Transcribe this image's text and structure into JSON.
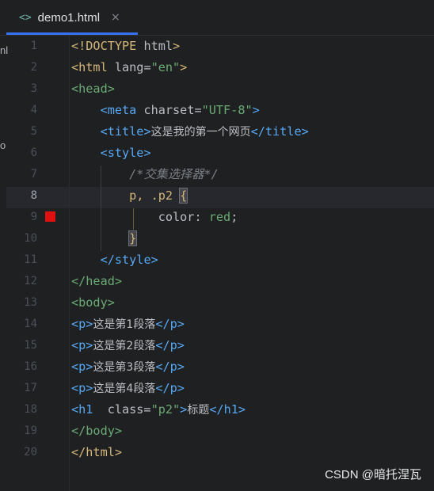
{
  "tab": {
    "icon": "<>",
    "filename": "demo1.html",
    "close": "×"
  },
  "edge_fragments": [
    "nl",
    "o"
  ],
  "gutter": {
    "breakpoint_line": 9,
    "current_line": 8
  },
  "lines": [
    {
      "n": "1",
      "segs": [
        {
          "t": "<!DOCTYPE ",
          "c": "tag"
        },
        {
          "t": "html",
          "c": "att"
        },
        {
          "t": ">",
          "c": "tag"
        }
      ]
    },
    {
      "n": "2",
      "segs": [
        {
          "t": "<html ",
          "c": "tag"
        },
        {
          "t": "lang=",
          "c": "att"
        },
        {
          "t": "\"en\"",
          "c": "str"
        },
        {
          "t": ">",
          "c": "tag"
        }
      ]
    },
    {
      "n": "3",
      "segs": [
        {
          "t": "<head>",
          "c": "str"
        }
      ]
    },
    {
      "n": "4",
      "segs": [
        {
          "t": "    ",
          "c": "att"
        },
        {
          "t": "<meta ",
          "c": "sty"
        },
        {
          "t": "charset=",
          "c": "att"
        },
        {
          "t": "\"UTF-8\"",
          "c": "str"
        },
        {
          "t": ">",
          "c": "sty"
        }
      ]
    },
    {
      "n": "5",
      "segs": [
        {
          "t": "    ",
          "c": "att"
        },
        {
          "t": "<title>",
          "c": "sty"
        },
        {
          "t": "这是我的第一个网页",
          "c": "cn"
        },
        {
          "t": "</title>",
          "c": "sty"
        }
      ]
    },
    {
      "n": "6",
      "segs": [
        {
          "t": "    ",
          "c": "att"
        },
        {
          "t": "<style>",
          "c": "sty"
        }
      ]
    },
    {
      "n": "7",
      "segs": [
        {
          "t": "        ",
          "c": "att"
        },
        {
          "t": "/*交集选择器*/",
          "c": "cmt"
        }
      ]
    },
    {
      "n": "8",
      "segs": [
        {
          "t": "        ",
          "c": "att"
        },
        {
          "t": "p, .p2 ",
          "c": "tag"
        },
        {
          "t": "{",
          "c": "tag brace-hl"
        }
      ]
    },
    {
      "n": "9",
      "segs": [
        {
          "t": "            ",
          "c": "att"
        },
        {
          "t": "color",
          "c": "att"
        },
        {
          "t": ": ",
          "c": "att"
        },
        {
          "t": "red",
          "c": "str"
        },
        {
          "t": ";",
          "c": "att"
        }
      ]
    },
    {
      "n": "10",
      "segs": [
        {
          "t": "        ",
          "c": "att"
        },
        {
          "t": "}",
          "c": "tag brace-hl"
        }
      ]
    },
    {
      "n": "11",
      "segs": [
        {
          "t": "    ",
          "c": "att"
        },
        {
          "t": "</style>",
          "c": "sty"
        }
      ]
    },
    {
      "n": "12",
      "segs": [
        {
          "t": "</head>",
          "c": "str"
        }
      ]
    },
    {
      "n": "13",
      "segs": [
        {
          "t": "<body>",
          "c": "str"
        }
      ]
    },
    {
      "n": "14",
      "segs": [
        {
          "t": "<p>",
          "c": "sty"
        },
        {
          "t": "这是第1段落",
          "c": "cn"
        },
        {
          "t": "</p>",
          "c": "sty"
        }
      ]
    },
    {
      "n": "15",
      "segs": [
        {
          "t": "<p>",
          "c": "sty"
        },
        {
          "t": "这是第2段落",
          "c": "cn"
        },
        {
          "t": "</p>",
          "c": "sty"
        }
      ]
    },
    {
      "n": "16",
      "segs": [
        {
          "t": "<p>",
          "c": "sty"
        },
        {
          "t": "这是第3段落",
          "c": "cn"
        },
        {
          "t": "</p>",
          "c": "sty"
        }
      ]
    },
    {
      "n": "17",
      "segs": [
        {
          "t": "<p>",
          "c": "sty"
        },
        {
          "t": "这是第4段落",
          "c": "cn"
        },
        {
          "t": "</p>",
          "c": "sty"
        }
      ]
    },
    {
      "n": "18",
      "segs": [
        {
          "t": "<h1  ",
          "c": "sty"
        },
        {
          "t": "class=",
          "c": "att"
        },
        {
          "t": "\"p2\"",
          "c": "str"
        },
        {
          "t": ">",
          "c": "sty"
        },
        {
          "t": "标题",
          "c": "cn"
        },
        {
          "t": "</h1>",
          "c": "sty"
        }
      ]
    },
    {
      "n": "19",
      "segs": [
        {
          "t": "</body>",
          "c": "str"
        }
      ]
    },
    {
      "n": "20",
      "segs": [
        {
          "t": "</html>",
          "c": "tag"
        }
      ]
    }
  ],
  "watermark": "CSDN @暗托涅瓦"
}
